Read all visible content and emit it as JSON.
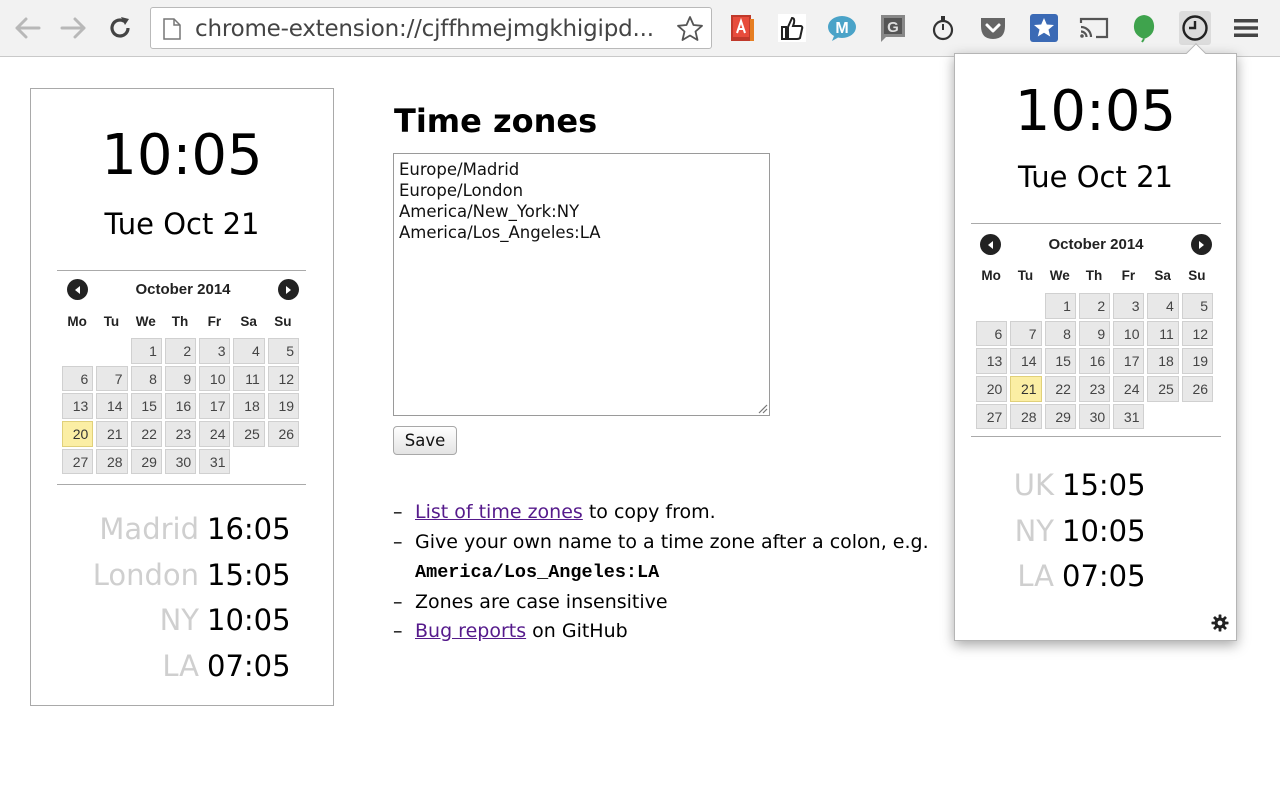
{
  "browser": {
    "url": "chrome-extension://cjffhmejmgkhigipd...",
    "extensions": [
      "pdf-reader-icon",
      "thumbs-up-icon",
      "m-bubble-icon",
      "g-extension-icon",
      "stopwatch-icon",
      "pocket-icon",
      "bookmark-star-icon",
      "cast-icon",
      "leaf-icon",
      "clock-icon"
    ]
  },
  "preview": {
    "time": "10:05",
    "date": "Tue Oct 21",
    "calendar": {
      "title": "October 2014",
      "weekdays": [
        "Mo",
        "Tu",
        "We",
        "Th",
        "Fr",
        "Sa",
        "Su"
      ],
      "days": [
        "",
        "",
        "1",
        "2",
        "3",
        "4",
        "5",
        "6",
        "7",
        "8",
        "9",
        "10",
        "11",
        "12",
        "13",
        "14",
        "15",
        "16",
        "17",
        "18",
        "19",
        "20",
        "21",
        "22",
        "23",
        "24",
        "25",
        "26",
        "27",
        "28",
        "29",
        "30",
        "31"
      ],
      "highlighted": "20"
    },
    "zones": [
      {
        "name": "Madrid",
        "time": "16:05"
      },
      {
        "name": "London",
        "time": "15:05"
      },
      {
        "name": "NY",
        "time": "10:05"
      },
      {
        "name": "LA",
        "time": "07:05"
      }
    ]
  },
  "options": {
    "title": "Time zones",
    "zones_text": "Europe/Madrid\nEurope/London\nAmerica/New_York:NY\nAmerica/Los_Angeles:LA",
    "save_label": "Save",
    "help": {
      "dash": "–",
      "item1_link": "List of time zones",
      "item1_rest": " to copy from.",
      "item2_text": "Give your own name to a time zone after a colon, e.g.",
      "item2_code": "America/Los_Angeles:LA",
      "item3_text": "Zones are case insensitive",
      "item4_link": "Bug reports",
      "item4_rest": " on GitHub"
    }
  },
  "popup": {
    "time": "10:05",
    "date": "Tue Oct 21",
    "calendar": {
      "title": "October 2014",
      "weekdays": [
        "Mo",
        "Tu",
        "We",
        "Th",
        "Fr",
        "Sa",
        "Su"
      ],
      "days": [
        "",
        "",
        "1",
        "2",
        "3",
        "4",
        "5",
        "6",
        "7",
        "8",
        "9",
        "10",
        "11",
        "12",
        "13",
        "14",
        "15",
        "16",
        "17",
        "18",
        "19",
        "20",
        "21",
        "22",
        "23",
        "24",
        "25",
        "26",
        "27",
        "28",
        "29",
        "30",
        "31"
      ],
      "highlighted": "21"
    },
    "zones": [
      {
        "name": "UK",
        "time": "15:05"
      },
      {
        "name": "NY",
        "time": "10:05"
      },
      {
        "name": "LA",
        "time": "07:05"
      }
    ]
  },
  "colors": {
    "today_highlight": "#fbeea4",
    "zone_name": "#cfcfcf",
    "link": "#551a8b",
    "toolbar": "#f2f2f2"
  }
}
